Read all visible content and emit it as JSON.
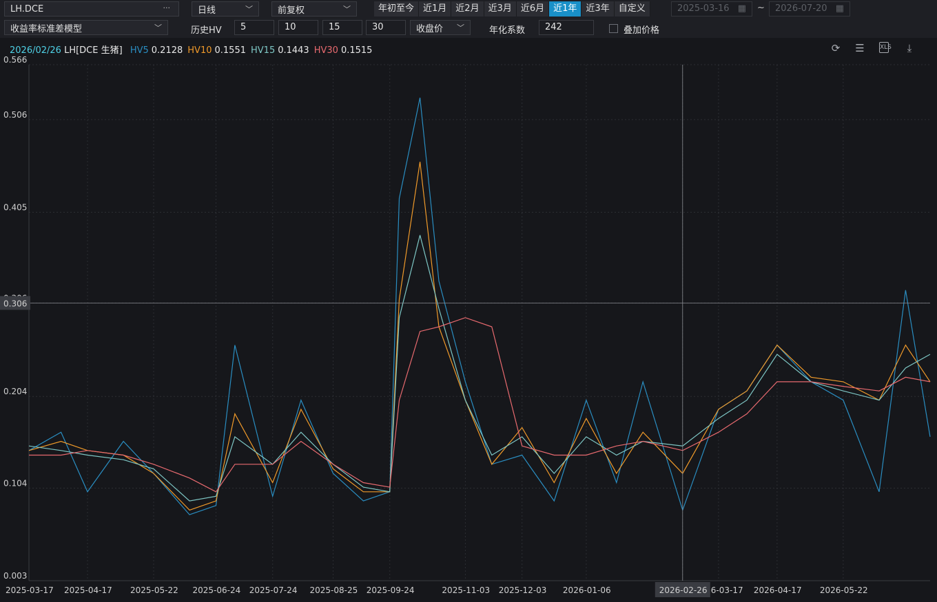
{
  "toolbar": {
    "symbol": "LH.DCE",
    "symbol_more": "···",
    "period": "日线",
    "adjust": "前复权",
    "ranges": [
      "年初至今",
      "近1月",
      "近2月",
      "近3月",
      "近6月",
      "近1年",
      "近3年",
      "自定义"
    ],
    "active_range": "近1年",
    "start_date": "2025-03-16",
    "tilde": "~",
    "end_date": "2026-07-20"
  },
  "settings": {
    "model": "收益率标准差模型",
    "hv_label": "历史HV",
    "hv_windows": [
      "5",
      "10",
      "15",
      "30"
    ],
    "price_type": "收盘价",
    "annual_label": "年化系数",
    "annual_factor": "242",
    "overlay_label": "叠加价格"
  },
  "legend": {
    "date": "2026/02/26",
    "instrument": "LH[DCE 生猪]",
    "items": [
      {
        "name": "HV5",
        "value": "0.2128",
        "color": "#2a8ec2"
      },
      {
        "name": "HV10",
        "value": "0.1551",
        "color": "#f09a2a"
      },
      {
        "name": "HV15",
        "value": "0.1443",
        "color": "#7ec7c5"
      },
      {
        "name": "HV30",
        "value": "0.1515",
        "color": "#e86a6f"
      }
    ]
  },
  "icons": [
    "refresh-icon",
    "menu-icon",
    "xls-export-icon",
    "download-icon"
  ],
  "crosshair": {
    "y_label": "0.306",
    "x_label": "2026-02-26"
  },
  "chart_data": {
    "type": "line",
    "y_ticks": [
      "0.566",
      "0.506",
      "0.405",
      "0.306",
      "0.204",
      "0.104",
      "0.003"
    ],
    "ylim": [
      0.003,
      0.566
    ],
    "x_ticks": [
      "2025-03-17",
      "2025-04-17",
      "2025-05-22",
      "2025-06-24",
      "2025-07-24",
      "2025-08-25",
      "2025-09-24",
      "2025-11-03",
      "2025-12-03",
      "2026-01-06",
      "2026-02-26",
      "2026-03-17",
      "2026-04-17",
      "2026-05-22"
    ],
    "x": [
      "2025-03-17",
      "2025-04-03",
      "2025-04-17",
      "2025-05-06",
      "2025-05-22",
      "2025-06-10",
      "2025-06-24",
      "2025-07-04",
      "2025-07-24",
      "2025-08-08",
      "2025-08-25",
      "2025-09-10",
      "2025-09-24",
      "2025-09-29",
      "2025-10-10",
      "2025-10-20",
      "2025-11-03",
      "2025-11-17",
      "2025-12-03",
      "2025-12-20",
      "2026-01-06",
      "2026-01-22",
      "2026-02-05",
      "2026-02-26",
      "2026-03-17",
      "2026-04-01",
      "2026-04-17",
      "2026-05-05",
      "2026-05-22",
      "2026-06-10",
      "2026-06-24",
      "2026-07-07"
    ],
    "series": [
      {
        "name": "HV5",
        "color": "#2a8ec2",
        "values": [
          0.145,
          0.165,
          0.1,
          0.155,
          0.12,
          0.075,
          0.085,
          0.26,
          0.095,
          0.2,
          0.12,
          0.09,
          0.1,
          0.42,
          0.53,
          0.33,
          0.22,
          0.13,
          0.14,
          0.09,
          0.2,
          0.11,
          0.22,
          0.08,
          0.19,
          0.21,
          0.26,
          0.22,
          0.2,
          0.1,
          0.32,
          0.16
        ]
      },
      {
        "name": "HV10",
        "color": "#f09a2a",
        "values": [
          0.145,
          0.155,
          0.145,
          0.14,
          0.12,
          0.08,
          0.09,
          0.185,
          0.11,
          0.19,
          0.125,
          0.1,
          0.1,
          0.31,
          0.46,
          0.28,
          0.2,
          0.13,
          0.17,
          0.11,
          0.18,
          0.12,
          0.165,
          0.12,
          0.19,
          0.21,
          0.26,
          0.225,
          0.22,
          0.2,
          0.26,
          0.22
        ]
      },
      {
        "name": "HV15",
        "color": "#7ec7c5",
        "values": [
          0.15,
          0.145,
          0.14,
          0.135,
          0.125,
          0.09,
          0.095,
          0.16,
          0.13,
          0.165,
          0.13,
          0.105,
          0.1,
          0.29,
          0.38,
          0.3,
          0.2,
          0.14,
          0.16,
          0.12,
          0.16,
          0.14,
          0.155,
          0.15,
          0.18,
          0.2,
          0.25,
          0.22,
          0.21,
          0.2,
          0.235,
          0.25
        ]
      },
      {
        "name": "HV30",
        "color": "#e86a6f",
        "values": [
          0.14,
          0.14,
          0.145,
          0.14,
          0.13,
          0.115,
          0.1,
          0.13,
          0.13,
          0.155,
          0.13,
          0.11,
          0.105,
          0.2,
          0.275,
          0.28,
          0.29,
          0.28,
          0.15,
          0.14,
          0.14,
          0.15,
          0.155,
          0.145,
          0.165,
          0.185,
          0.22,
          0.22,
          0.215,
          0.21,
          0.225,
          0.22
        ]
      }
    ]
  }
}
